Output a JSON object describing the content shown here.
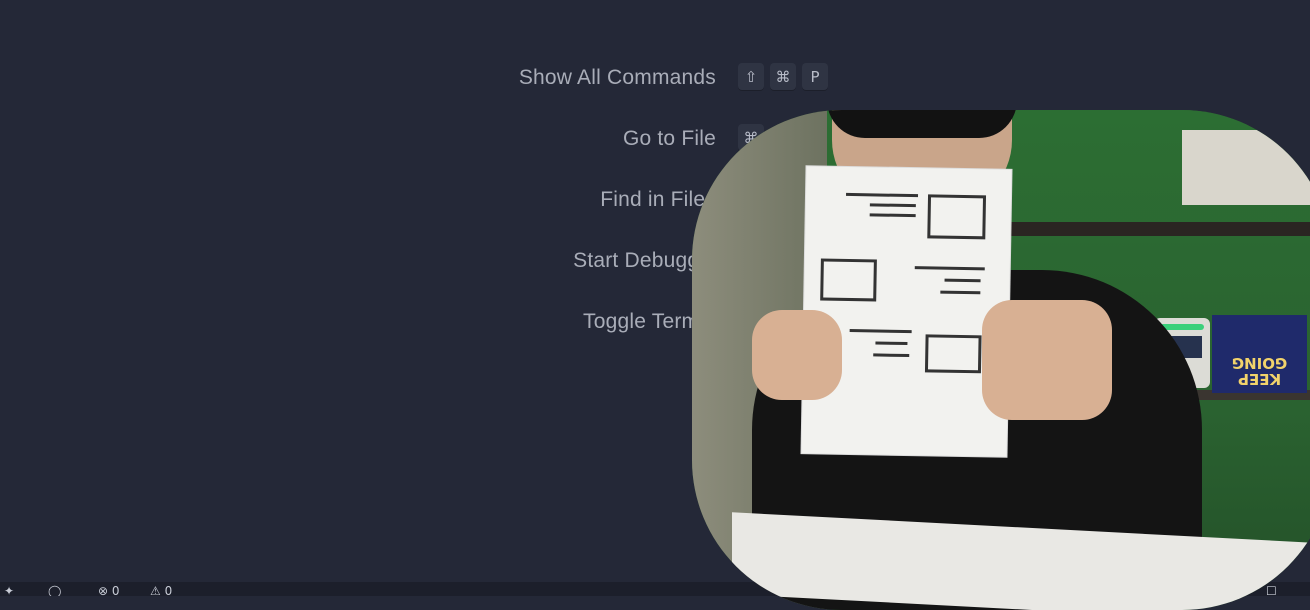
{
  "shortcuts": [
    {
      "label": "Show All Commands",
      "keys": [
        "⇧",
        "⌘",
        "P"
      ]
    },
    {
      "label": "Go to File",
      "keys": [
        "⌘"
      ]
    },
    {
      "label": "Find in Files",
      "keys": []
    },
    {
      "label": "Start Debuggin",
      "keys": []
    },
    {
      "label": "Toggle Termin",
      "keys": []
    }
  ],
  "webcam": {
    "book_text": "KEEP GOING"
  },
  "status_bar": {
    "problems_errors": "⊗ 0",
    "problems_warnings": "⚠ 0"
  }
}
